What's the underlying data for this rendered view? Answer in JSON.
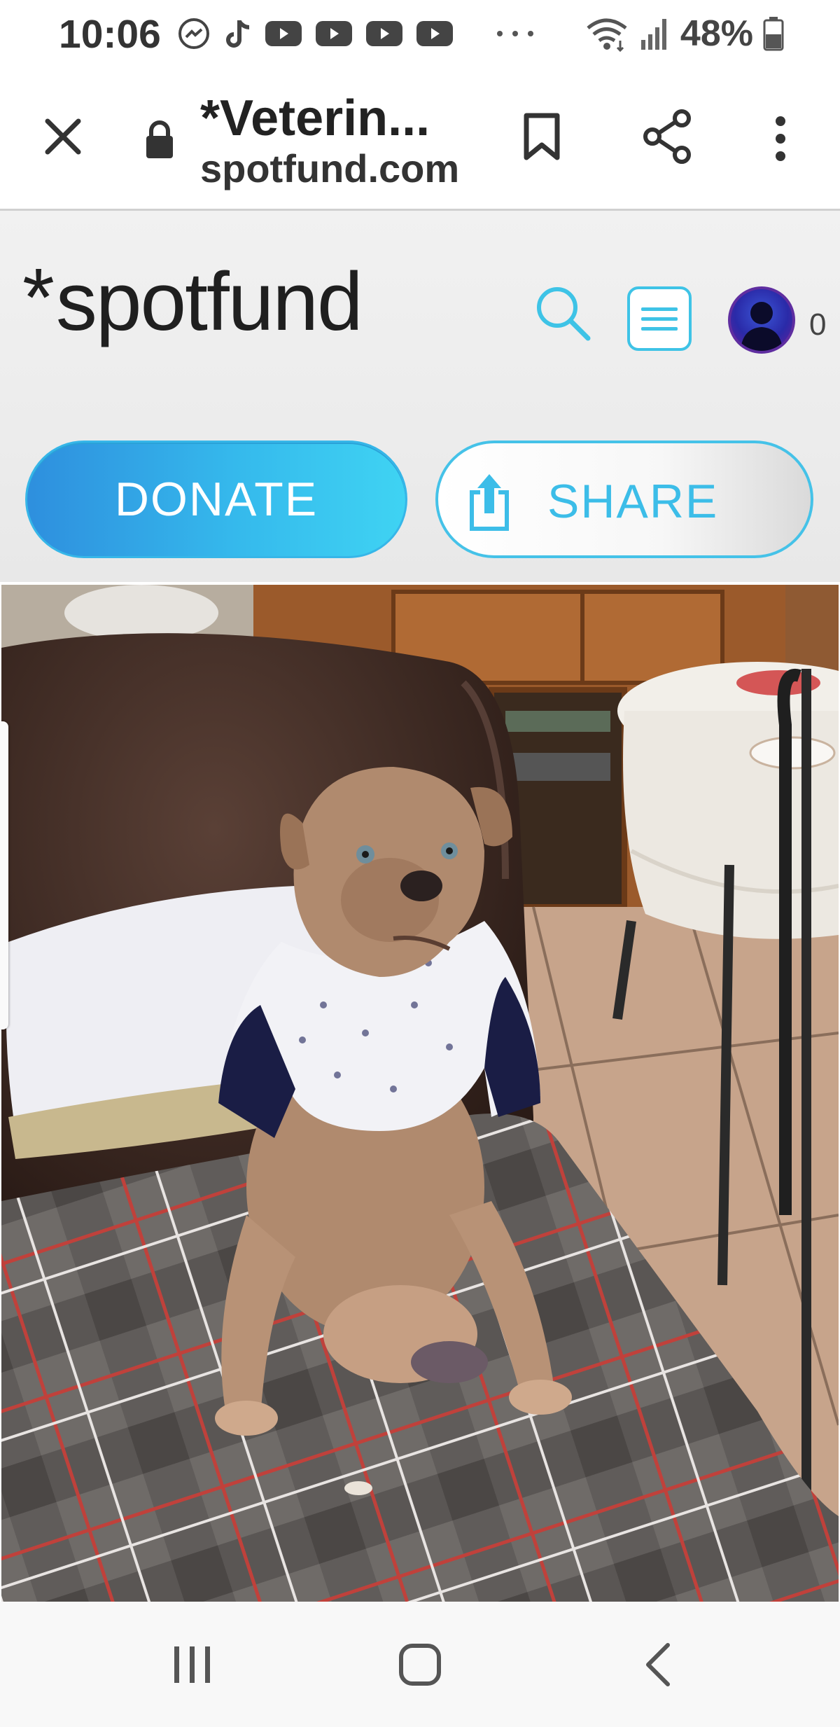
{
  "status_bar": {
    "time": "10:06",
    "notification_icons": [
      "messenger-icon",
      "tiktok-icon",
      "youtube-icon",
      "youtube-icon",
      "youtube-icon",
      "youtube-icon",
      "more-dots-icon"
    ],
    "battery_percent": "48%"
  },
  "browser": {
    "page_title": "*Veterin...",
    "url": "spotfund.com"
  },
  "site": {
    "logo_text": "spotfund",
    "logo_mark": "*",
    "notification_count": "0",
    "donate_label": "DONATE",
    "share_label": "SHARE",
    "accent_color": "#3ec3e6"
  },
  "photo": {
    "alt_subject": "dog-photo"
  }
}
